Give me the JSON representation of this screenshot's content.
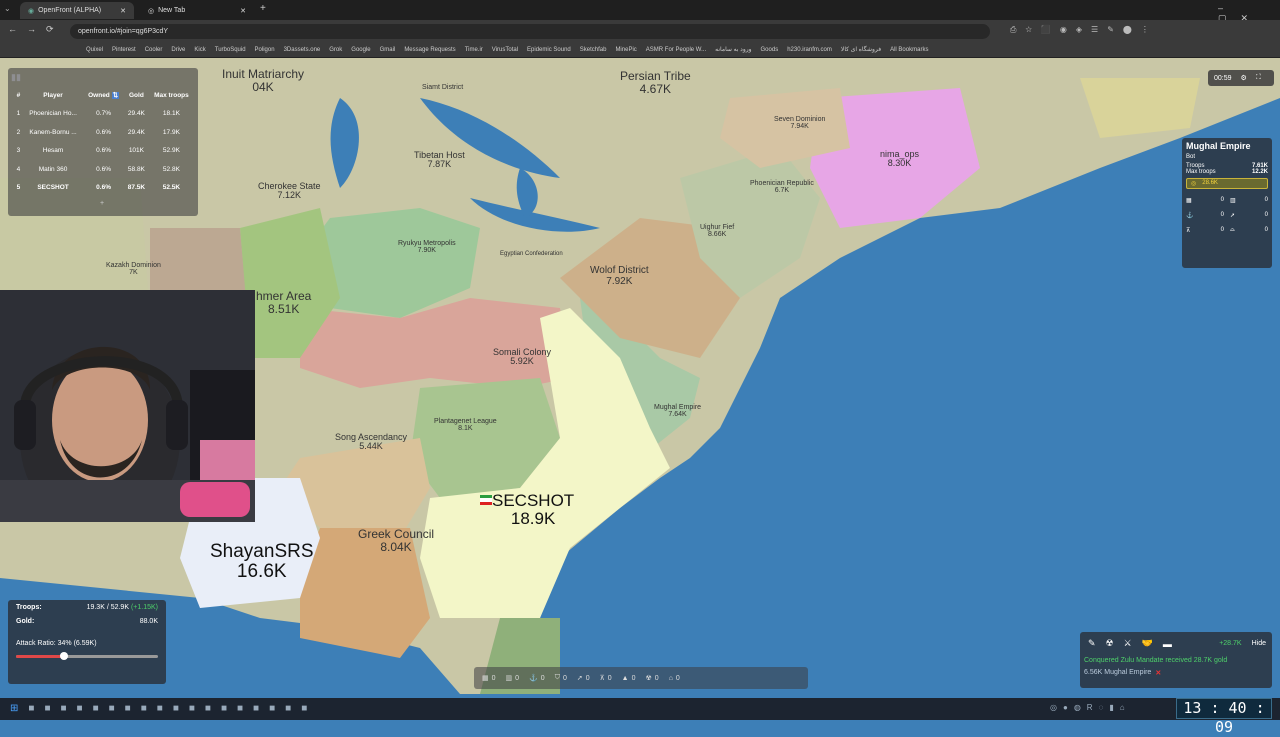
{
  "browser": {
    "tabs": [
      {
        "title": "OpenFront (ALPHA)",
        "active": true
      },
      {
        "title": "New Tab",
        "active": false
      }
    ],
    "url": "openfront.io/#join=qg6P3cdY",
    "bookmarks": [
      "Quixel",
      "Pinterest",
      "Cooler",
      "Drive",
      "Kick",
      "TurboSquid",
      "Poligon",
      "3Dassets.one",
      "Grok",
      "Google",
      "Gmail",
      "Message Requests",
      "Time.ir",
      "VirusTotal",
      "Epidemic Sound",
      "Sketchfab",
      "MinePic",
      "ASMR For People W...",
      "ورود به سامانه",
      "Goods",
      "h230.iranfm.com",
      "فروشگاه ای کالا",
      "All Bookmarks"
    ]
  },
  "map": {
    "colors": {
      "ocean": "#3d7fb7",
      "land": "#c9c7a6",
      "player": "#f3f6c8",
      "shayan": "#e9eef8"
    },
    "territories": [
      {
        "name": "Inuit Matriarchy",
        "value": "04K"
      },
      {
        "name": "Persian Tribe",
        "value": "4.67K"
      },
      {
        "name": "Siamt District",
        "value": ""
      },
      {
        "name": "Tibetan Host",
        "value": "7.87K"
      },
      {
        "name": "Seven Dominion",
        "value": "7.94K"
      },
      {
        "name": "nima_ops",
        "value": "8.30K"
      },
      {
        "name": "Cherokee State",
        "value": "7.12K"
      },
      {
        "name": "Ryukyu Metropolis",
        "value": "7.90K"
      },
      {
        "name": "Egyptian Confederation",
        "value": ""
      },
      {
        "name": "Phoenician Republic",
        "value": "6.7K"
      },
      {
        "name": "Uighur Fief",
        "value": "8.66K"
      },
      {
        "name": "Kazakh Dominion",
        "value": "7K"
      },
      {
        "name": "Wolof District",
        "value": "7.92K"
      },
      {
        "name": "hmer Area",
        "value": "8.51K"
      },
      {
        "name": "Somali Colony",
        "value": "5.92K"
      },
      {
        "name": "Mughal Empire",
        "value": "7.64K"
      },
      {
        "name": "Plantagenet League",
        "value": "8.1K"
      },
      {
        "name": "Song Ascendancy",
        "value": "5.44K"
      },
      {
        "name": "SECSHOT",
        "value": "18.9K"
      },
      {
        "name": "Greek Council",
        "value": "8.04K"
      },
      {
        "name": "ShayanSRS",
        "value": "16.6K"
      }
    ]
  },
  "leaderboard": {
    "headers": [
      "#",
      "Player",
      "Owned",
      "Gold",
      "Max troops"
    ],
    "rows": [
      {
        "rank": "1",
        "player": "Phoenician Ho...",
        "owned": "0.7%",
        "gold": "29.4K",
        "troops": "18.1K"
      },
      {
        "rank": "2",
        "player": "Kanem-Bornu ...",
        "owned": "0.6%",
        "gold": "29.4K",
        "troops": "17.9K"
      },
      {
        "rank": "3",
        "player": "Hesam",
        "owned": "0.6%",
        "gold": "101K",
        "troops": "52.9K"
      },
      {
        "rank": "4",
        "player": "Matin 360",
        "owned": "0.6%",
        "gold": "58.8K",
        "troops": "52.8K"
      },
      {
        "rank": "5",
        "player": "SECSHOT",
        "owned": "0.6%",
        "gold": "87.5K",
        "troops": "52.5K"
      }
    ],
    "more": "+"
  },
  "timer": "00:59",
  "player_info": {
    "name": "Mughal Empire",
    "type": "Bot",
    "troops_label": "Troops",
    "troops": "7.61K",
    "max_label": "Max troops",
    "max": "12.2K",
    "gold": "28.6K",
    "buildings": [
      "0",
      "0",
      "0",
      "0",
      "0",
      "0"
    ]
  },
  "stats": {
    "troops_label": "Troops:",
    "troops": "19.3K / 52.9K",
    "troops_rate": "(+1.15K)",
    "gold_label": "Gold:",
    "gold": "88.0K",
    "attack_ratio": "Attack Ratio: 34% (6.59K)",
    "attack_ratio_value": 0.34
  },
  "buildbar": {
    "counts": [
      "0",
      "0",
      "0",
      "0",
      "0",
      "0",
      "0",
      "0",
      "0"
    ]
  },
  "events": {
    "gold_gain": "+28.7K",
    "hide": "Hide",
    "message": "Conquered Zulu Mandate received 28.7K gold",
    "attack": "6.56K Mughal Empire"
  },
  "clock": "13 : 40 : 09"
}
